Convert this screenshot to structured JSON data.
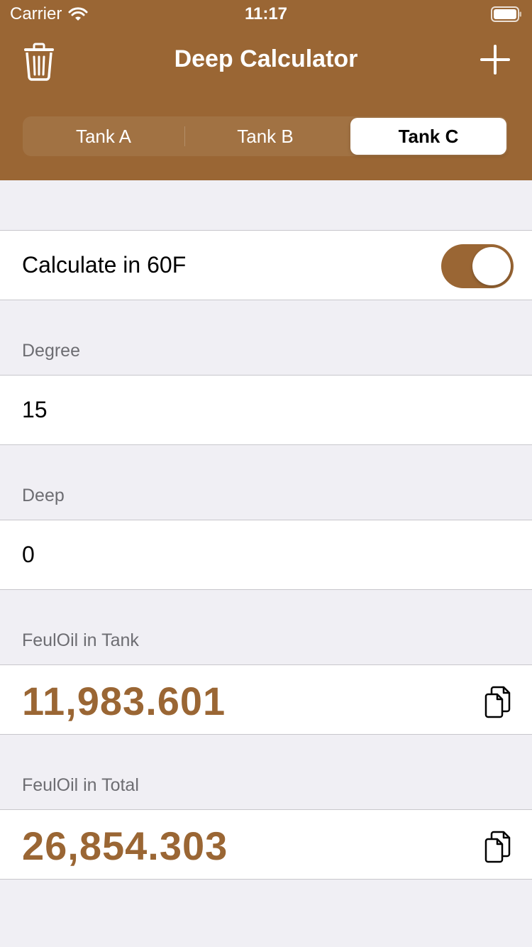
{
  "status": {
    "carrier": "Carrier",
    "time": "11:17"
  },
  "nav": {
    "title": "Deep Calculator",
    "left_icon": "trash-icon",
    "right_icon": "plus-icon"
  },
  "tabs": [
    {
      "label": "Tank A",
      "selected": false
    },
    {
      "label": "Tank B",
      "selected": false
    },
    {
      "label": "Tank C",
      "selected": true
    }
  ],
  "settings": {
    "calc_label": "Calculate in 60F",
    "calc_enabled": true
  },
  "fields": {
    "degree": {
      "label": "Degree",
      "value": "15"
    },
    "deep": {
      "label": "Deep",
      "value": "0"
    }
  },
  "results": {
    "tank": {
      "label": "FeulOil in Tank",
      "value": "11,983.601"
    },
    "total": {
      "label": "FeulOil in Total",
      "value": "26,854.303"
    }
  },
  "colors": {
    "accent": "#9a6634",
    "background": "#f0eff4"
  }
}
